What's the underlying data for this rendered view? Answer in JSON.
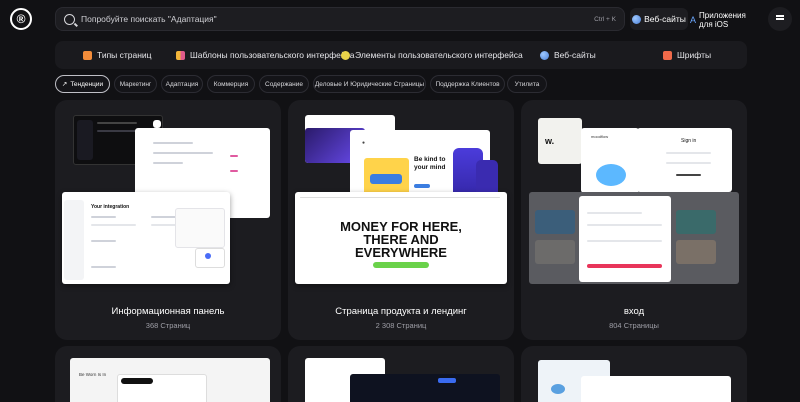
{
  "header": {
    "logo": "®",
    "search_placeholder": "Попробуйте поискать \"Адаптация\"",
    "search_shortcut": "Ctrl + K",
    "websites_button": "Веб-сайты",
    "ios_app_line1": "Приложения",
    "ios_app_line2": "для iOS"
  },
  "categories": [
    {
      "label": "Типы страниц",
      "icon": "page-types-icon",
      "color": "#f28c3a"
    },
    {
      "label": "Шаблоны пользовательского интерфейса",
      "icon": "ui-patterns-icon",
      "color": "#f2b53a"
    },
    {
      "label": "Элементы пользовательского интерфейса",
      "icon": "ui-elements-icon",
      "color": "#e9d24a"
    },
    {
      "label": "Веб-сайты",
      "icon": "globe-icon",
      "color": "#6aa7ff"
    },
    {
      "label": "Шрифты",
      "icon": "fonts-icon",
      "color": "#f06a4a"
    }
  ],
  "tags": [
    {
      "label": "Тенденции",
      "active": true
    },
    {
      "label": "Маркетинг",
      "active": false
    },
    {
      "label": "Адаптация",
      "active": false
    },
    {
      "label": "Коммерция",
      "active": false
    },
    {
      "label": "Содержание",
      "active": false
    },
    {
      "label": "Деловые И Юридические Страницы",
      "active": false
    },
    {
      "label": "Поддержка Клиентов",
      "active": false
    },
    {
      "label": "Утилита",
      "active": false
    }
  ],
  "cards": [
    {
      "title": "Информационная панель",
      "count": "368 Страниц"
    },
    {
      "title": "Страница продукта и лендинг",
      "count": "2 308 Страниц"
    },
    {
      "title": "вход",
      "count": "804 Страницы"
    }
  ],
  "thumb_text": {
    "money_line1": "MONEY FOR HERE,",
    "money_line2": "THERE AND",
    "money_line3": "EVERYWHERE",
    "be_kind": "Be kind to your mind",
    "signin": "Sign in",
    "signin_brand": "w.",
    "moodflow": "moodflow",
    "dashboard_title": "Your integration",
    "bottom_card_text": "Be Worn Is In"
  },
  "colors": {
    "background": "#111114",
    "card": "#1c1c20",
    "accent_blue": "#6aa7ff"
  }
}
